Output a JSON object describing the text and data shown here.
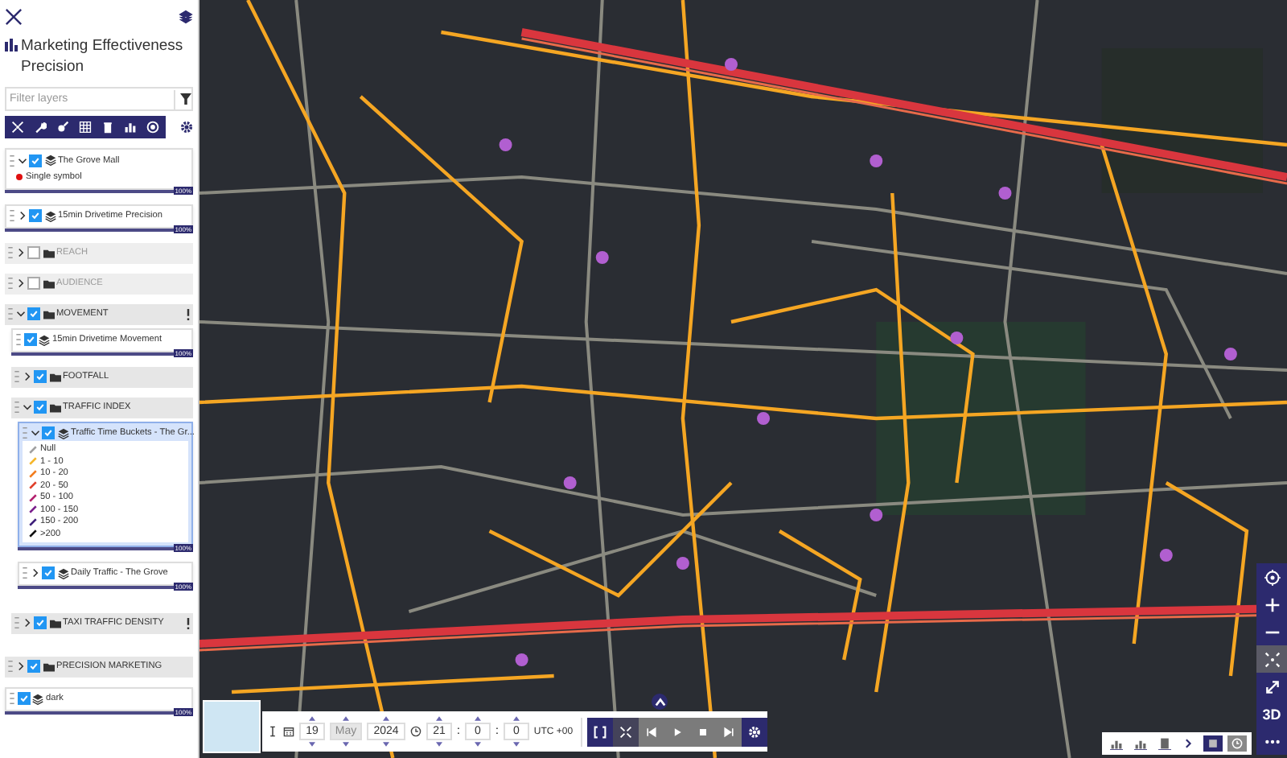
{
  "panel": {
    "title": "Marketing Effectiveness Precision",
    "filter": {
      "placeholder": "Filter layers"
    },
    "layers": [
      {
        "kind": "layer",
        "name": "The Grove Mall",
        "checked": true,
        "expanded": true,
        "selected": false,
        "opacity": "100%",
        "level": 1,
        "legend": [
          {
            "label": "Single symbol",
            "color": "#e01010",
            "kind": "dot"
          }
        ]
      },
      {
        "kind": "layer",
        "name": "15min Drivetime Precision",
        "checked": true,
        "expanded": false,
        "selected": false,
        "opacity": "100%",
        "level": 1
      },
      {
        "kind": "group",
        "name": "REACH",
        "checked": false,
        "expanded": false
      },
      {
        "kind": "group",
        "name": "AUDIENCE",
        "checked": false,
        "expanded": false
      },
      {
        "kind": "group",
        "name": "MOVEMENT",
        "checked": true,
        "expanded": true,
        "menu": true,
        "children": [
          {
            "kind": "layer",
            "name": "15min Drivetime Movement",
            "checked": true,
            "selected": false,
            "opacity": "100%",
            "level": 1
          },
          {
            "kind": "group",
            "name": "FOOTFALL",
            "checked": true,
            "expanded": false
          },
          {
            "kind": "group",
            "name": "TRAFFIC INDEX",
            "checked": true,
            "expanded": true,
            "children": [
              {
                "kind": "layer",
                "name": "Traffic Time Buckets - The Gr...",
                "checked": true,
                "expanded": true,
                "selected": true,
                "opacity": "100%",
                "level": 1,
                "legend": [
                  {
                    "label": "Null",
                    "color": "#a0a0a0",
                    "kind": "line"
                  },
                  {
                    "label": "1 - 10",
                    "color": "#f5b62a",
                    "kind": "line"
                  },
                  {
                    "label": "10 - 20",
                    "color": "#f27c1e",
                    "kind": "line"
                  },
                  {
                    "label": "20 - 50",
                    "color": "#e0402a",
                    "kind": "line"
                  },
                  {
                    "label": "50 - 100",
                    "color": "#b3206e",
                    "kind": "line"
                  },
                  {
                    "label": "100 - 150",
                    "color": "#7a1f8c",
                    "kind": "line"
                  },
                  {
                    "label": "150 - 200",
                    "color": "#3e1f7a",
                    "kind": "line"
                  },
                  {
                    "label": ">200",
                    "color": "#111111",
                    "kind": "line"
                  }
                ]
              },
              {
                "kind": "layer",
                "name": "Daily Traffic - The Grove",
                "checked": true,
                "expanded": false,
                "selected": false,
                "opacity": "100%",
                "level": 1
              }
            ]
          },
          {
            "kind": "group",
            "name": "TAXI TRAFFIC DENSITY",
            "checked": true,
            "expanded": false,
            "menu": true
          }
        ]
      },
      {
        "kind": "group",
        "name": "PRECISION MARKETING",
        "checked": true,
        "expanded": false
      },
      {
        "kind": "layer",
        "name": "dark",
        "checked": true,
        "selected": false,
        "opacity": "100%",
        "level": 1
      }
    ]
  },
  "timebar": {
    "day": "19",
    "month": "May",
    "year": "2024",
    "hour": "21",
    "minute": "0",
    "second": "0",
    "separator": ":",
    "timezone": "UTC +00"
  },
  "map_controls": {
    "three_d": "3D"
  }
}
